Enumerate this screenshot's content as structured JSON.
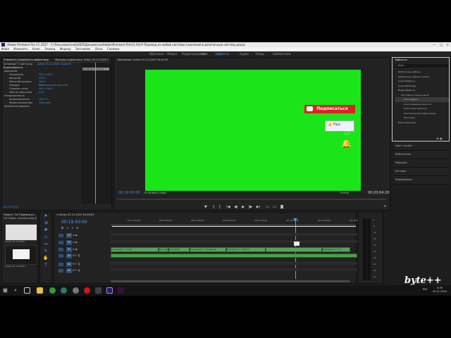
{
  "window": {
    "title": "Adobe Premiere Pro CC 2017 - C:\\Пользователи\\USER\\Документы\\Adobe\\Premiere Pro\\11.0\\C# Перевод из любой системы счисления в десятичную систему.prproj"
  },
  "menu": [
    "Файл",
    "Изменить",
    "Клип",
    "Эпизод",
    "Маркер",
    "Заголовок",
    "Окно",
    "Справка"
  ],
  "workspaces": {
    "items": [
      "Обучение",
      "Сборка",
      "Редактирование",
      "Цвет",
      "Эффекты",
      "Аудио",
      "Титры",
      "Библиотеки"
    ],
    "active": "Эффекты"
  },
  "effect_controls": {
    "tabs": [
      "Элементы управления эффектами",
      "Микшер аудиоклипа: Action 22-11-2020 1"
    ],
    "source_label": "Основной * Слой 3.png",
    "sequence_label": "Action 22-11-2020 16-26-05",
    "section": "Видеоэффекты",
    "rows": [
      {
        "label": "Движение",
        "value": ""
      },
      {
        "label": "Положение",
        "value": "960,0    540,0"
      },
      {
        "label": "Масштаб",
        "value": "100,0"
      },
      {
        "label": "Масштаб ширины",
        "value": "100,0"
      },
      {
        "label": "",
        "value": "Равномерный масштаб"
      },
      {
        "label": "Поворот",
        "value": "0,0"
      },
      {
        "label": "Опорная точка",
        "value": "960,0    540,0"
      },
      {
        "label": "Фильтр мерцания",
        "value": "0,00"
      },
      {
        "label": "Непрозрачность",
        "value": ""
      },
      {
        "label": "Непрозрачность",
        "value": "100,0 %"
      },
      {
        "label": "Режим наложения",
        "value": "Обычный"
      },
      {
        "label": "Изменение времени",
        "value": ""
      }
    ],
    "mini_clip": "Основной 1 * Слой 3",
    "timecode": "00:19:50:05"
  },
  "program": {
    "tab": "Программа: Action 22-11-2020 16-26-05",
    "timecode_current": "00:19:50:00",
    "fit": "По размеру кадра",
    "quality": "Полное",
    "timecode_duration": "00:20:04:20",
    "overlay_subscribe": "Подписаться",
    "overlay_like": "Нра"
  },
  "effects_panel": {
    "title": "Эффекты",
    "search_placeholder": "Клип",
    "tree": [
      "Шаблонные наборы",
      "Шаблонные наборы Lumetri",
      "Аудиоэффекты",
      "Аудиопереходы",
      "Видеоэффекты",
      "Противоположные цвета",
      "Клип-эффект",
      "Клип-смещение яркости",
      "Клип-эскиз дорожки",
      "Клип-масштаб изображения",
      "Клип-ярко",
      "Видеопереходы"
    ],
    "sections": [
      "Цвет Lumetri",
      "Библиотеки",
      "Маркеры",
      "История",
      "Информация"
    ]
  },
  "project": {
    "title": "Проект: C# Перевод из...",
    "item1": "C# Перев...системы.prproj",
    "thumb1_label": "Action 22-11-2020...",
    "thumb2_label": "Action 22-11-2020...",
    "timecode_small": "00:19:50:05"
  },
  "timeline": {
    "tab": "Action 22-11-2020 16-26-05",
    "timecode": "00:19:50:00",
    "ruler": [
      "00:17:00:00",
      "00:18:00:00",
      "00:19:00:00",
      "00:20:00:00",
      "00:21:00:00",
      "00:22:00:00",
      "00:23:00:00",
      "00:24:00:00"
    ],
    "tracks_video": [
      "V3",
      "V2",
      "V1"
    ],
    "tracks_audio": [
      "A1",
      "A2",
      "A3"
    ],
    "clips_v1": [
      "Основной 1 * Слой",
      "Основной 1",
      "Основной",
      "Основной 1 * Основной",
      "Основной 1 * Слой 3",
      "Основной 1 * Сл"
    ]
  },
  "audio_meter": {
    "scale": [
      "0",
      "-6",
      "-12",
      "-18",
      "-24",
      "-30",
      "-36",
      "-42",
      "-48",
      "-54"
    ]
  },
  "taskbar": {
    "time": "0:39",
    "date": "25.11.2020",
    "lang": "РУС"
  },
  "watermark": "byte++"
}
